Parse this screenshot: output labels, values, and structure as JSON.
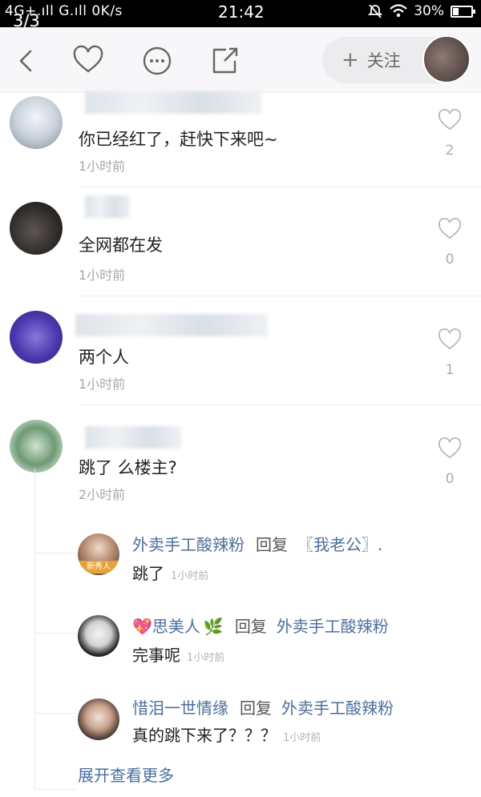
{
  "status_bar": {
    "network": "4G+.ıll G.ıll 0K/s",
    "time": "21:42",
    "battery": "30%",
    "battery_level": 0.3
  },
  "page_counter": "3/3",
  "toolbar": {
    "icons": [
      "back-icon",
      "heart-icon",
      "more-icon",
      "share-icon"
    ],
    "follow_label": "关注",
    "follow_plus": "+"
  },
  "comments": [
    {
      "text": "你已经红了，赶快下来吧~",
      "time": "1小时前",
      "likes": "2"
    },
    {
      "text": "全网都在发",
      "time": "1小时前",
      "likes": "0"
    },
    {
      "text": "两个人",
      "time": "1小时前",
      "likes": "1"
    },
    {
      "text": "跳了 么楼主?",
      "time": "2小时前",
      "likes": "0"
    }
  ],
  "replies": [
    {
      "user": "外卖手工酸辣粉",
      "reply_word": "回复",
      "target": "〖我老公〗.",
      "text": "跳了",
      "time": "1小时前",
      "badge": "新秀人"
    },
    {
      "user": "思美人",
      "reply_word": "回复",
      "target": "外卖手工酸辣粉",
      "text": "完事呢",
      "time": "1小时前"
    },
    {
      "user": "惜泪一世情缘",
      "reply_word": "回复",
      "target": "外卖手工酸辣粉",
      "text": "真的跳下来了？？？",
      "time": "1小时前"
    }
  ],
  "expand_label": "展开查看更多",
  "colors": {
    "link_blue": "#4b6f9c",
    "time_gray": "#a3a8ae"
  }
}
